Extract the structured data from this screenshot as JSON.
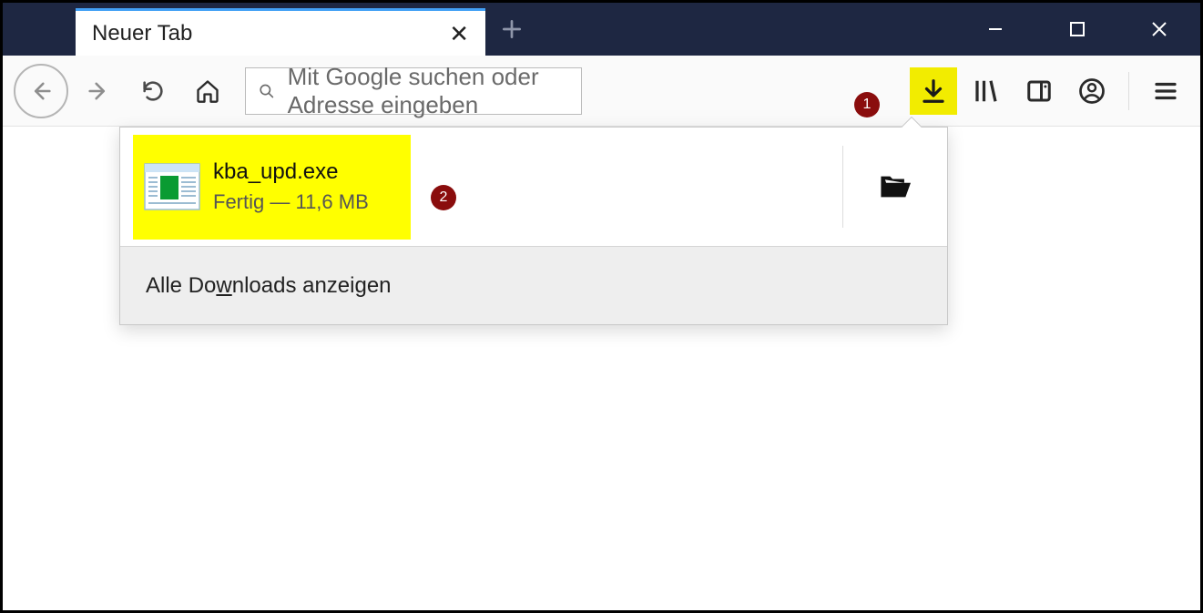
{
  "tab": {
    "title": "Neuer Tab"
  },
  "urlbar": {
    "placeholder": "Mit Google suchen oder Adresse eingeben"
  },
  "annotations": {
    "badge1": "1",
    "badge2": "2"
  },
  "downloads_panel": {
    "items": [
      {
        "filename": "kba_upd.exe",
        "status": "Fertig — 11,6 MB"
      }
    ],
    "show_all_prefix": "Alle Do",
    "show_all_ul": "w",
    "show_all_suffix": "nloads anzeigen"
  }
}
